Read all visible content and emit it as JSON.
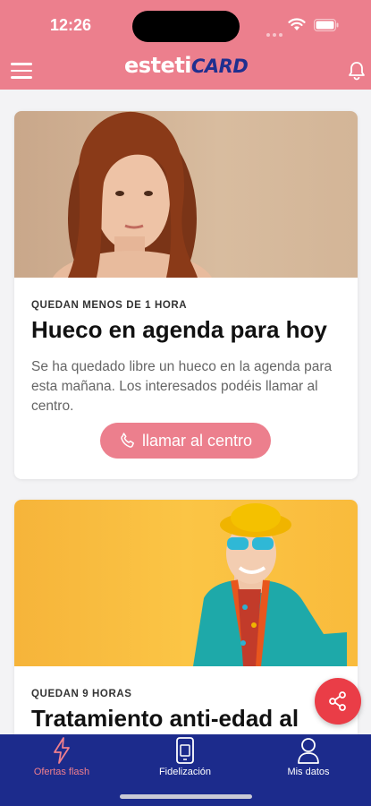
{
  "status": {
    "time": "12:26"
  },
  "header": {
    "logo_part1": "esteti",
    "logo_part2": "CARD"
  },
  "offers": [
    {
      "eyebrow": "QUEDAN MENOS DE 1 HORA",
      "title": "Hueco en agenda para hoy",
      "description": "Se ha quedado libre un hueco en la agenda para esta mañana. Los interesados podéis llamar al centro.",
      "button_label": "llamar al centro"
    },
    {
      "eyebrow": "QUEDAN 9 HORAS",
      "title": "Tratamiento anti-edad al"
    }
  ],
  "tabs": [
    {
      "label": "Ofertas flash",
      "active": true
    },
    {
      "label": "Fidelización",
      "active": false
    },
    {
      "label": "Mis datos",
      "active": false
    }
  ],
  "colors": {
    "brand_pink": "#ec7f8d",
    "navy": "#1c2b8c",
    "fab_red": "#ea3d47"
  }
}
